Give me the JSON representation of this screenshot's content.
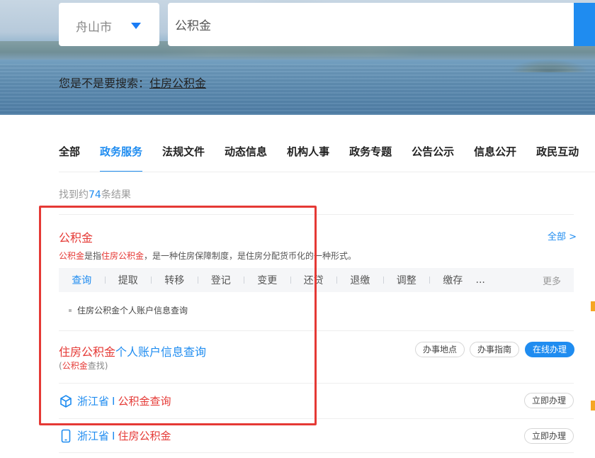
{
  "header": {
    "city": "舟山市",
    "search_value": "公积金",
    "suggest_prefix": "您是不是要搜索：",
    "suggest_link": "住房公积金"
  },
  "tabs": [
    {
      "label": "全部",
      "active": false
    },
    {
      "label": "政务服务",
      "active": true
    },
    {
      "label": "法规文件",
      "active": false
    },
    {
      "label": "动态信息",
      "active": false
    },
    {
      "label": "机构人事",
      "active": false
    },
    {
      "label": "政务专题",
      "active": false
    },
    {
      "label": "公告公示",
      "active": false
    },
    {
      "label": "信息公开",
      "active": false
    },
    {
      "label": "政民互动",
      "active": false
    }
  ],
  "results": {
    "count_prefix": "找到约",
    "count": "74",
    "count_suffix": "条结果"
  },
  "card": {
    "title": "公积金",
    "all_link": "全部 >",
    "desc_hl1": "公积金",
    "desc_mid1": "是指",
    "desc_hl2": "住房公积金",
    "desc_rest": "，是一种住房保障制度，是住房分配货币化的一种形式。",
    "actions": [
      "查询",
      "提取",
      "转移",
      "登记",
      "变更",
      "还贷",
      "退缴",
      "调整",
      "缴存",
      "..."
    ],
    "more": "更多",
    "sub_item": "住房公积金个人账户信息查询"
  },
  "row1": {
    "title_hl": "住房公积金",
    "title_rest": "个人账户信息查询",
    "sub_open": "(",
    "sub_hl": "公积金",
    "sub_rest": "查找)",
    "btn_location": "办事地点",
    "btn_guide": "办事指南",
    "btn_online": "在线办理"
  },
  "row2": {
    "province": "浙江省",
    "sep": "I",
    "title": "公积金查询",
    "btn": "立即办理"
  },
  "row3": {
    "province": "浙江省",
    "sep": "I",
    "title": "住房公积金",
    "btn": "立即办理"
  },
  "colors": {
    "accent": "#1f8cf0",
    "highlight": "#e53935",
    "annotation_box": "#e53935"
  }
}
